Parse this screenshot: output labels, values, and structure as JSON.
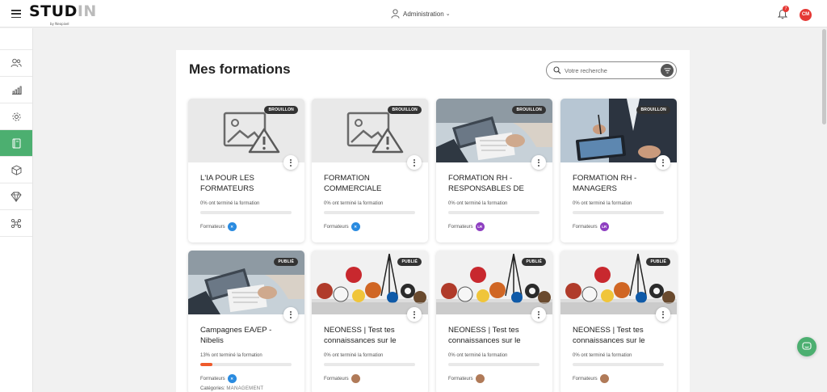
{
  "app": {
    "logo_text": "STUD",
    "logo_subtitle": "by Neopixel",
    "menu_icon": "hamburger-icon"
  },
  "header": {
    "admin_label": "Administration",
    "notification_count": "7",
    "user_initials": "CM",
    "user_color": "#e53935"
  },
  "sidebar": {
    "accent": "#4caf70",
    "items": [
      {
        "icon": "users-icon",
        "active": false
      },
      {
        "icon": "bar-chart-icon",
        "active": false
      },
      {
        "icon": "gear-icon",
        "active": false
      },
      {
        "icon": "book-icon",
        "active": true
      },
      {
        "icon": "cube-icon",
        "active": false
      },
      {
        "icon": "diamond-icon",
        "active": false
      },
      {
        "icon": "network-icon",
        "active": false
      }
    ]
  },
  "main": {
    "title": "Mes formations",
    "search_placeholder": "Votre recherche",
    "trainers_label": "Formateurs",
    "categories_label": "Catégories:",
    "cards": [
      {
        "title": "L'IA POUR LES FORMATEURS",
        "status": "BROUILLON",
        "image": "placeholder",
        "progress_text": "0%  ont terminé la formation",
        "progress_pct": 0,
        "trainer_initials": "",
        "trainer_color": "#2a8be0"
      },
      {
        "title": "FORMATION COMMERCIALE",
        "status": "BROUILLON",
        "image": "placeholder",
        "progress_text": "0%  ont terminé la formation",
        "progress_pct": 0,
        "trainer_initials": "",
        "trainer_color": "#2a8be0"
      },
      {
        "title": "FORMATION RH - RESPONSABLES DE",
        "status": "BROUILLON",
        "image": "office",
        "progress_text": "0%  ont terminé la formation",
        "progress_pct": 0,
        "trainer_initials": "LR",
        "trainer_color": "#8e3fc1"
      },
      {
        "title": "FORMATION RH - MANAGERS",
        "status": "BROUILLON",
        "image": "business",
        "progress_text": "0%  ont terminé la formation",
        "progress_pct": 0,
        "trainer_initials": "LR",
        "trainer_color": "#8e3fc1"
      },
      {
        "title": "Campagnes EA/EP - Nibelis",
        "status": "PUBLIÉ",
        "image": "office",
        "progress_text": "13%  ont terminé la formation",
        "progress_pct": 13,
        "trainer_initials": "",
        "trainer_color": "#2a8be0",
        "category": "MANAGEMENT"
      },
      {
        "title": "NEONESS | Test tes connaissances sur le",
        "status": "PUBLIÉ",
        "image": "sports",
        "progress_text": "0%  ont terminé la formation",
        "progress_pct": 0,
        "trainer_initials": "",
        "trainer_color": "#b07a58"
      },
      {
        "title": "NEONESS | Test tes connaissances sur le",
        "status": "PUBLIÉ",
        "image": "sports",
        "progress_text": "0%  ont terminé la formation",
        "progress_pct": 0,
        "trainer_initials": "",
        "trainer_color": "#b07a58"
      },
      {
        "title": "NEONESS | Test tes connaissances sur le",
        "status": "PUBLIÉ",
        "image": "sports",
        "progress_text": "0%  ont terminé la formation",
        "progress_pct": 0,
        "trainer_initials": "",
        "trainer_color": "#b07a58"
      }
    ]
  },
  "chat_icon": "chat-icon"
}
